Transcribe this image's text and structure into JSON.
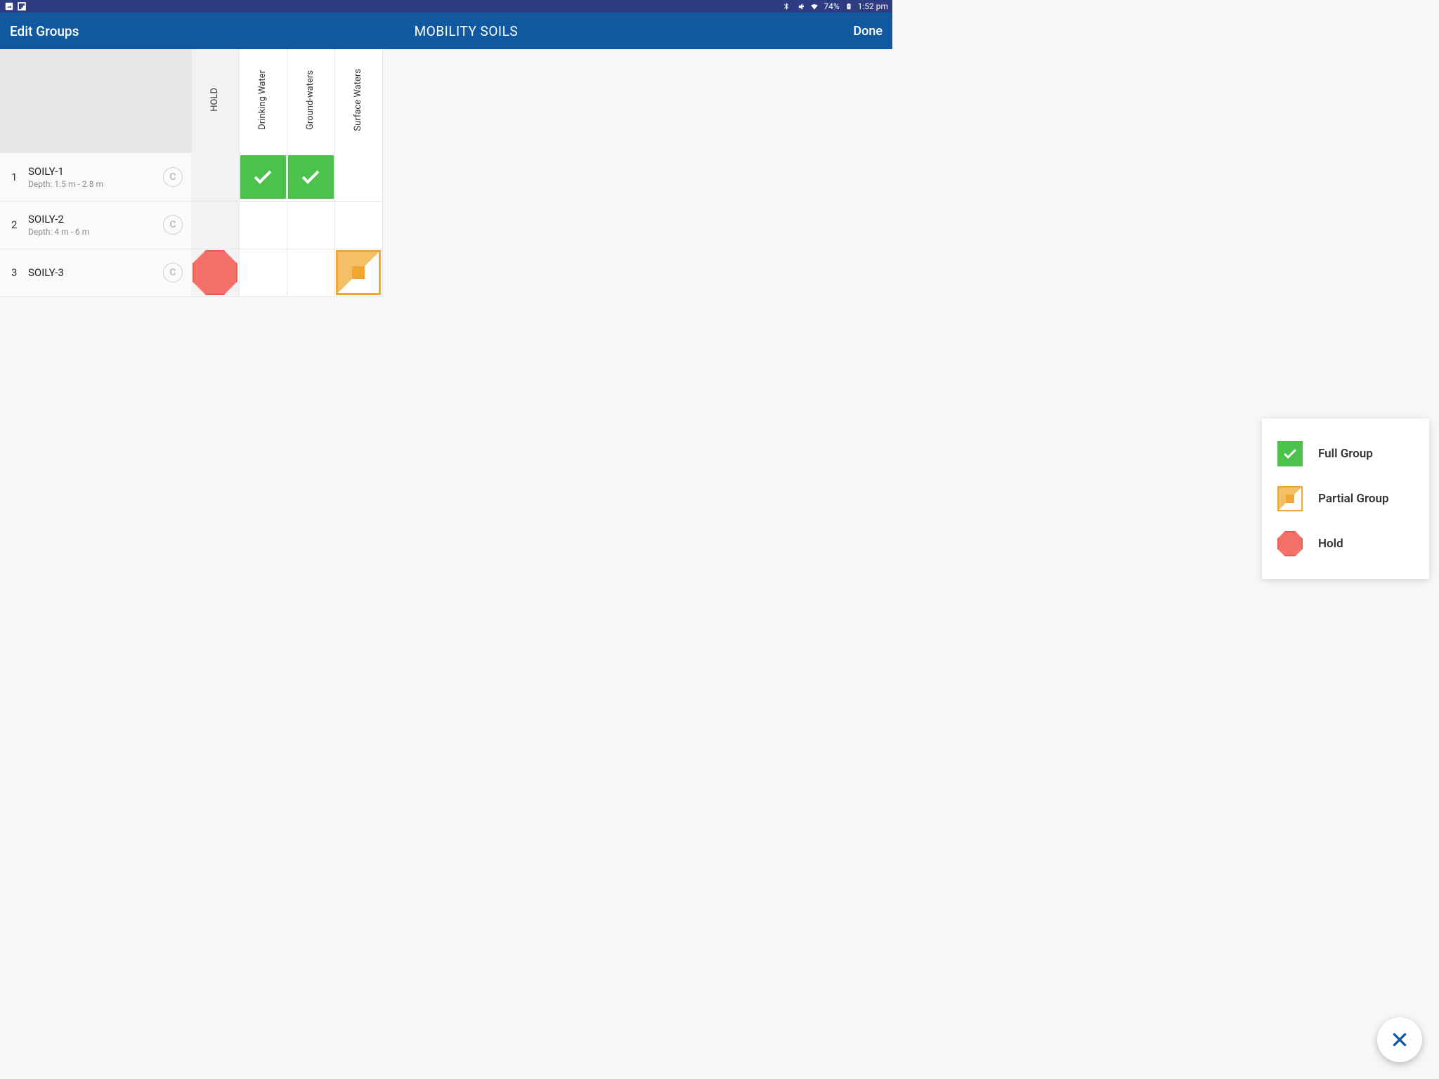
{
  "status": {
    "battery": "74%",
    "time": "1:52 pm"
  },
  "appbar": {
    "left": "Edit Groups",
    "title": "MOBILITY SOILS",
    "right": "Done"
  },
  "columns": {
    "hold": "HOLD",
    "drinking": "Drinking Water",
    "ground": "Ground-waters",
    "surface": "Surface Waters"
  },
  "rows": [
    {
      "num": "1",
      "title": "SOILY-1",
      "sub": "Depth: 1.5 m - 2.8 m",
      "badge": "C"
    },
    {
      "num": "2",
      "title": "SOILY-2",
      "sub": "Depth: 4 m - 6 m",
      "badge": "C"
    },
    {
      "num": "3",
      "title": "SOILY-3",
      "sub": "",
      "badge": "C"
    }
  ],
  "legend": {
    "full": "Full Group",
    "partial": "Partial Group",
    "hold": "Hold"
  }
}
